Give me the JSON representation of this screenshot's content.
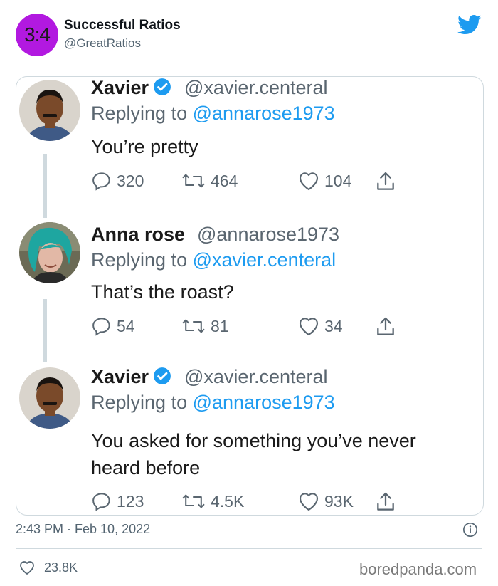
{
  "account": {
    "avatar_text": "3:4",
    "avatar_color": "#b219e0",
    "name": "Successful Ratios",
    "handle": "@GreatRatios",
    "platform_icon": "twitter-bird-icon"
  },
  "screenshot": {
    "tweets": [
      {
        "name": "Xavier",
        "verified": true,
        "handle": "@xavier.centeral",
        "reply_prefix": "Replying to",
        "reply_to": "@annarose1973",
        "text": "You’re pretty",
        "replies": "320",
        "retweets": "464",
        "likes": "104"
      },
      {
        "name": "Anna rose",
        "verified": false,
        "handle": "@annarose1973",
        "reply_prefix": "Replying to",
        "reply_to": "@xavier.centeral",
        "text": "That’s the roast?",
        "replies": "54",
        "retweets": "81",
        "likes": "34"
      },
      {
        "name": "Xavier",
        "verified": true,
        "handle": "@xavier.centeral",
        "reply_prefix": "Replying to",
        "reply_to": "@annarose1973",
        "text_line1": "You asked for something you’ve never",
        "text_line2": "heard before",
        "replies": "123",
        "retweets": "4.5K",
        "likes": "93K"
      }
    ]
  },
  "footer": {
    "timestamp": "2:43 PM · Feb 10, 2022",
    "likes": "23.8K",
    "watermark": "boredpanda.com"
  },
  "colors": {
    "accent": "#1d9bf0",
    "muted": "#536471",
    "border": "#cfd9de"
  }
}
